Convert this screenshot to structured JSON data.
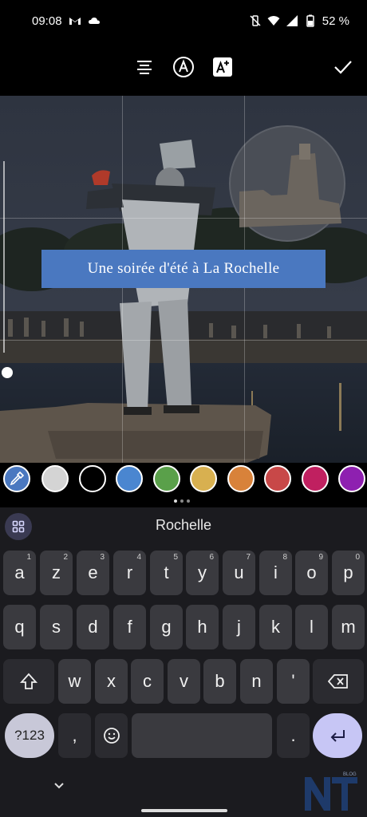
{
  "status_bar": {
    "time": "09:08",
    "battery": "52 %"
  },
  "toolbar": {
    "align_icon": "align-center-icon",
    "font_icon": "font-style-icon",
    "text_bg_icon": "text-background-icon",
    "done_icon": "check-icon"
  },
  "caption": {
    "text": "Une soirée d'été à La Rochelle",
    "background": "#4a78c0"
  },
  "palette": {
    "colors": [
      "#d4d4d4",
      "#000000",
      "#4a86d0",
      "#5aa04a",
      "#d8b050",
      "#d8823a",
      "#c84848",
      "#c02060",
      "#8e20b0"
    ]
  },
  "keyboard": {
    "suggestion": "Rochelle",
    "row1": [
      "a",
      "z",
      "e",
      "r",
      "t",
      "y",
      "u",
      "i",
      "o",
      "p"
    ],
    "row1_hints": [
      "1",
      "2",
      "3",
      "4",
      "5",
      "6",
      "7",
      "8",
      "9",
      "0"
    ],
    "row2": [
      "q",
      "s",
      "d",
      "f",
      "g",
      "h",
      "j",
      "k",
      "l",
      "m"
    ],
    "row3": [
      "w",
      "x",
      "c",
      "v",
      "b",
      "n",
      "'"
    ],
    "symbols_key": "?123",
    "comma_key": ",",
    "period_key": "."
  },
  "watermark": {
    "letters": "NT",
    "tag": "BLOG"
  }
}
